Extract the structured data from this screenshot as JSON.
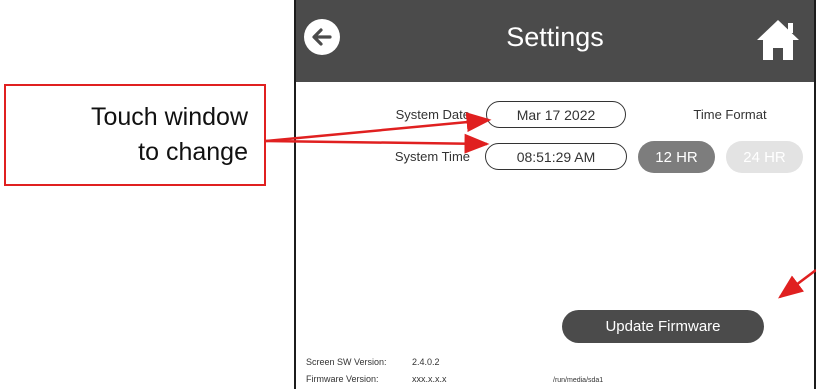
{
  "annotation": {
    "text_line1": "Touch window",
    "text_line2": "to change",
    "arrow_color": "#e02020"
  },
  "header": {
    "title": "Settings",
    "back_icon": "arrow-left-icon",
    "home_icon": "home-icon",
    "background": "#4b4b4b"
  },
  "date_time": {
    "system_date_label": "System Date",
    "system_date_value": "Mar 17 2022",
    "system_time_label": "System Time",
    "system_time_value": "08:51:29 AM"
  },
  "time_format": {
    "label": "Time Format",
    "options": [
      "12 HR",
      "24 HR"
    ],
    "selected": "12 HR"
  },
  "update_firmware_label": "Update Firmware",
  "versions": {
    "screen_sw_label": "Screen SW Version:",
    "screen_sw_value": "2.4.0.2",
    "firmware_label": "Firmware Version:",
    "firmware_value": "xxx.x.x.x"
  },
  "media_path": "/run/media/sda1"
}
